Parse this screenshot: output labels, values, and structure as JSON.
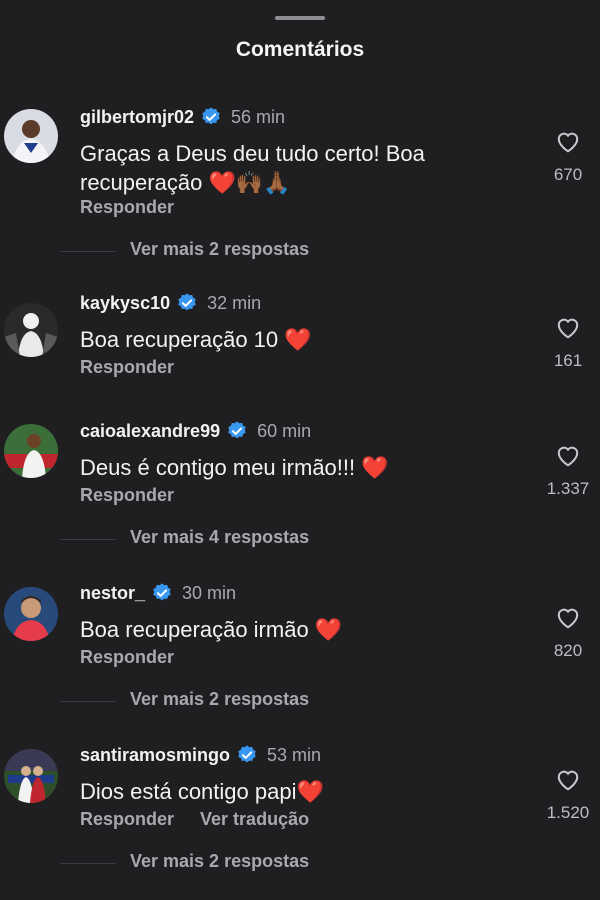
{
  "header": {
    "title": "Comentários"
  },
  "comments": [
    {
      "username": "gilbertomjr02",
      "time": "56 min",
      "text": "Graças a Deus deu tudo certo! Boa recuperação",
      "emojis": "❤️🙌🏾🙏🏾",
      "likes": "670",
      "reply_label": "Responder",
      "more_replies": "Ver mais 2 respostas"
    },
    {
      "username": "kaykysc10",
      "time": "32 min",
      "text": "Boa recuperação 10",
      "emojis": "❤️",
      "likes": "161",
      "reply_label": "Responder"
    },
    {
      "username": "caioalexandre99",
      "time": "60 min",
      "text": "Deus é contigo meu irmão!!!",
      "emojis": "❤️",
      "likes": "1.337",
      "reply_label": "Responder",
      "more_replies": "Ver mais 4 respostas"
    },
    {
      "username": "nestor_",
      "time": "30 min",
      "text": "Boa recuperação irmão",
      "emojis": "❤️",
      "likes": "820",
      "reply_label": "Responder",
      "more_replies": "Ver mais 2 respostas"
    },
    {
      "username": "santiramosmingo",
      "time": "53 min",
      "text": "Dios está contigo papi",
      "emojis": "❤️",
      "likes": "1.520",
      "reply_label": "Responder",
      "translate_label": "Ver tradução",
      "more_replies": "Ver mais 2 respostas"
    }
  ],
  "colors": {
    "background": "#1f1f22",
    "verified_badge": "#3897f0",
    "heart_emoji": "#e8263d",
    "secondary_text": "#a8a8ad"
  },
  "icons": {
    "verified": "verified-badge-icon",
    "like": "heart-outline-icon"
  }
}
